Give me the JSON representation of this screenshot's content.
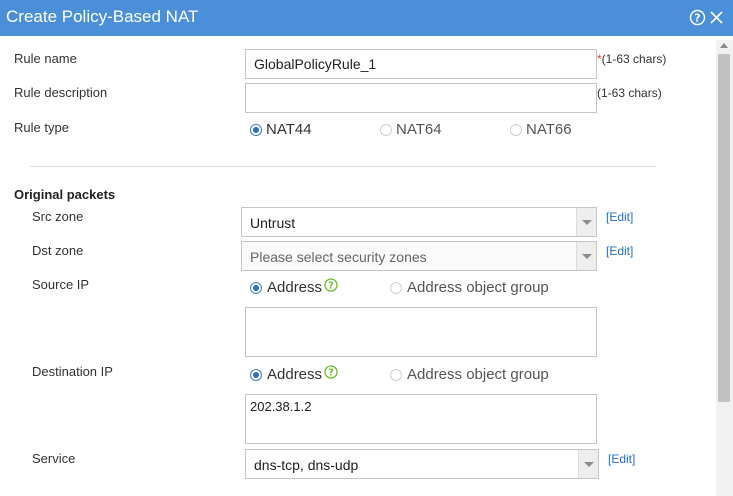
{
  "dialog": {
    "title": "Create Policy-Based NAT"
  },
  "rule": {
    "name_label": "Rule name",
    "name_value": "GlobalPolicyRule_1",
    "name_required": "*",
    "name_hint": "(1-63 chars)",
    "desc_label": "Rule description",
    "desc_value": "",
    "desc_hint": "(1-63 chars)",
    "type_label": "Rule type",
    "type_options": [
      "NAT44",
      "NAT64",
      "NAT66"
    ],
    "type_selected": "NAT44"
  },
  "original_packets": {
    "section_title": "Original packets",
    "src_zone_label": "Src zone",
    "src_zone_value": "Untrust",
    "dst_zone_label": "Dst zone",
    "dst_zone_placeholder": "Please select security zones",
    "edit_label": "[Edit]",
    "source_ip_label": "Source IP",
    "source_ip_value": "",
    "destination_ip_label": "Destination IP",
    "destination_ip_value": "202.38.1.2",
    "ip_mode_options": [
      "Address",
      "Address object group"
    ],
    "ip_mode_selected": "Address",
    "service_label": "Service",
    "service_value": "dns-tcp, dns-udp"
  },
  "colors": {
    "titlebar": "#4a8fd8",
    "link": "#1f6fc5",
    "required": "#e4393c",
    "help_icon": "#6cbf2a"
  }
}
